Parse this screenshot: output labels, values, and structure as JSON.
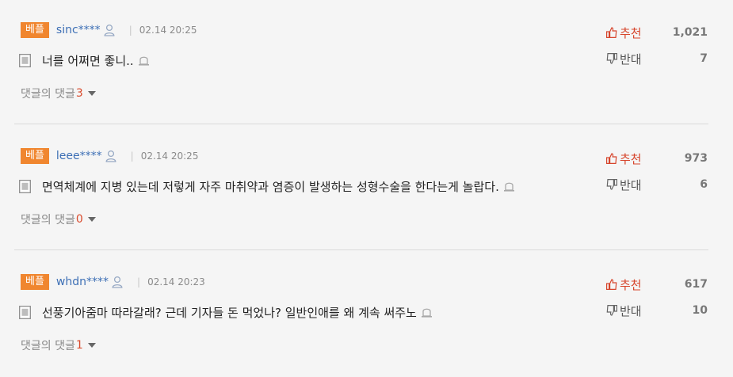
{
  "comments": [
    {
      "badge": "베플",
      "username": "sinc****",
      "separator": "|",
      "time": "02.14 20:25",
      "text": "너를 어쩌면 좋니..",
      "replies_label": "댓글의 댓글",
      "replies_count": "3",
      "upvote_label": "추천",
      "upvote_count": "1,021",
      "downvote_label": "반대",
      "downvote_count": "7"
    },
    {
      "badge": "베플",
      "username": "leee****",
      "separator": "|",
      "time": "02.14 20:25",
      "text": "면역체계에 지병 있는데 저렇게 자주 마취약과 염증이 발생하는 성형수술을 한다는게 놀랍다.",
      "replies_label": "댓글의 댓글",
      "replies_count": "0",
      "upvote_label": "추천",
      "upvote_count": "973",
      "downvote_label": "반대",
      "downvote_count": "6"
    },
    {
      "badge": "베플",
      "username": "whdn****",
      "separator": "|",
      "time": "02.14 20:23",
      "text": "선풍기아줌마 따라갈래? 근데 기자들 돈 먹었나? 일반인애를 왜 계속 써주노",
      "replies_label": "댓글의 댓글",
      "replies_count": "1",
      "upvote_label": "추천",
      "upvote_count": "617",
      "downvote_label": "반대",
      "downvote_count": "10"
    }
  ],
  "icons": {
    "user": "user-icon",
    "document": "document-icon",
    "report": "report-icon",
    "thumbs_up": "thumbs-up-icon",
    "thumbs_down": "thumbs-down-icon",
    "caret": "caret-down-icon"
  },
  "colors": {
    "badge": "#f0862f",
    "username": "#3d6fb5",
    "upvote": "#d6452c",
    "reply_count": "#d94a2c"
  }
}
